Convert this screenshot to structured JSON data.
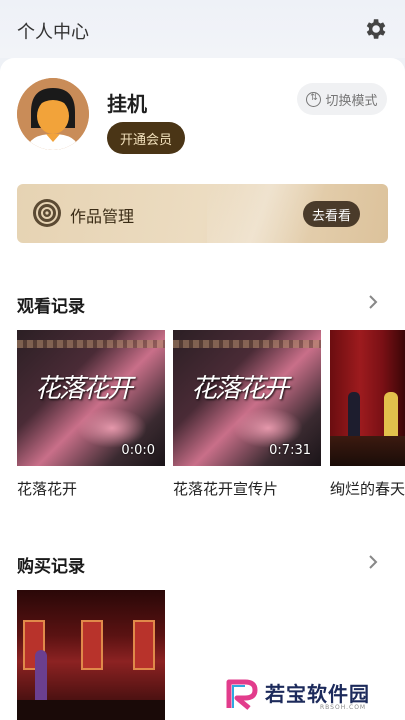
{
  "header": {
    "title": "个人中心",
    "settings_icon": "gear-icon"
  },
  "profile": {
    "username": "挂机",
    "vip_button": "开通会员",
    "mode_button": "切换模式",
    "mode_icon": "switch-icon",
    "avatar_icon": "user-avatar-icon"
  },
  "works": {
    "label": "作品管理",
    "button": "去看看",
    "icon": "target-icon"
  },
  "watch_history": {
    "title": "观看记录",
    "items": [
      {
        "title": "花落花开",
        "duration": "0:0:0",
        "poster_text": "花落花开"
      },
      {
        "title": "花落花开宣传片",
        "duration": "0:7:31",
        "poster_text": "花落花开"
      },
      {
        "title": "绚烂的春天",
        "duration": "",
        "poster_text": ""
      }
    ]
  },
  "purchase_history": {
    "title": "购买记录"
  },
  "watermark": {
    "text": "若宝软件园",
    "sub": "RBSOH.COM"
  },
  "colors": {
    "accent_dark": "#4a3516",
    "vip_text": "#f3e2bd",
    "card_gold": "#e6d3b3",
    "background": "#eef1f6"
  }
}
